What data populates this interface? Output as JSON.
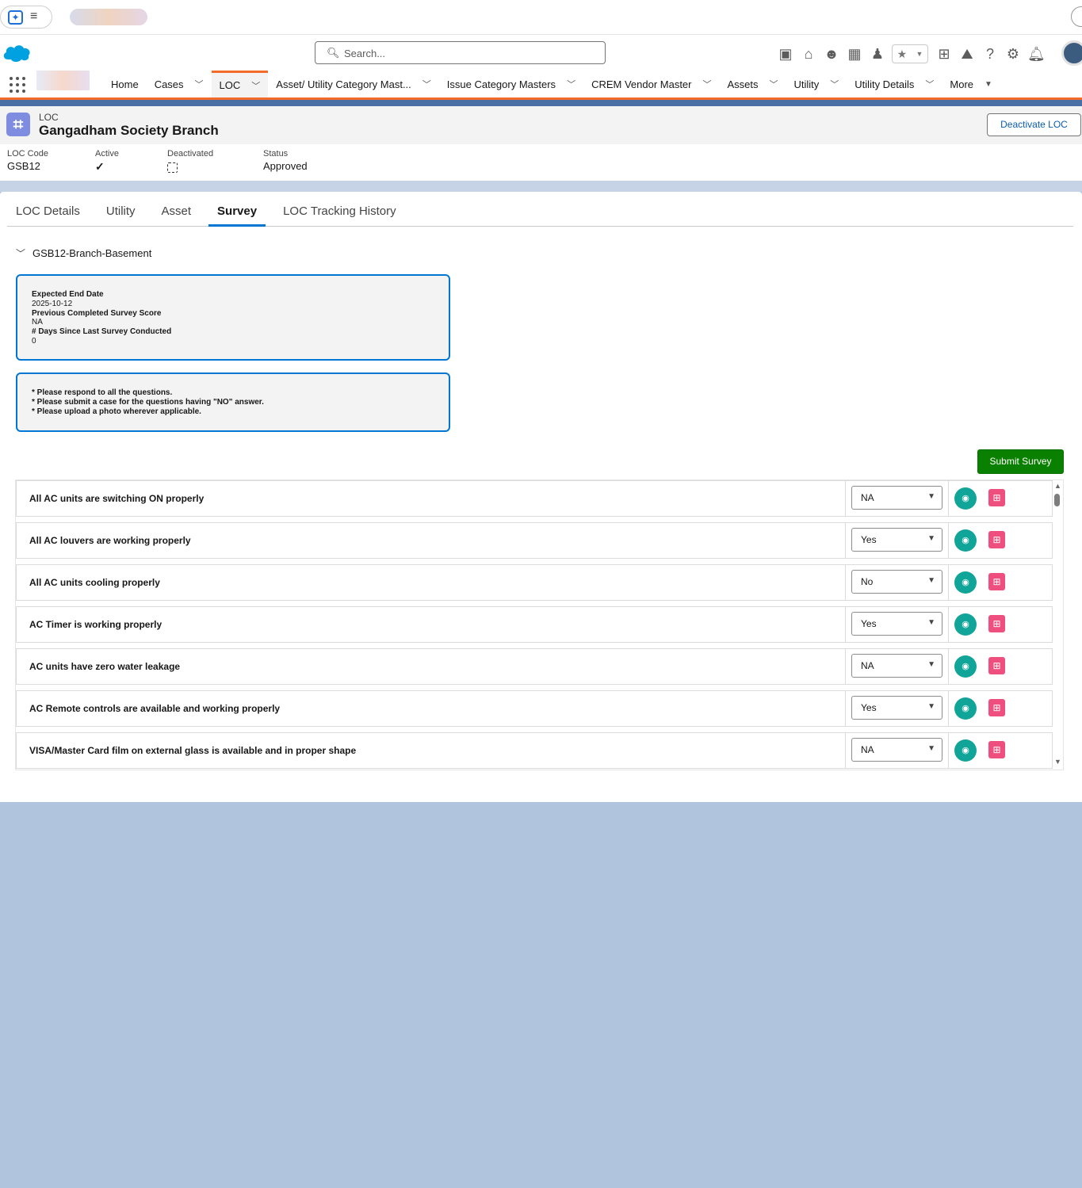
{
  "header": {
    "search_placeholder": "Search...",
    "icons": [
      "calendar-icon",
      "home-icon",
      "agent-icon",
      "dashboard-icon",
      "user-settings-icon",
      "plus-icon",
      "trailhead-icon",
      "help-icon",
      "gear-icon",
      "bell-icon"
    ]
  },
  "nav": {
    "items": [
      {
        "label": "Home",
        "chevron": false,
        "active": false
      },
      {
        "label": "Cases",
        "chevron": true,
        "active": false
      },
      {
        "label": "LOC",
        "chevron": true,
        "active": true
      },
      {
        "label": "Asset/ Utility Category Mast...",
        "chevron": true,
        "active": false
      },
      {
        "label": "Issue Category Masters",
        "chevron": true,
        "active": false
      },
      {
        "label": "CREM Vendor Master",
        "chevron": true,
        "active": false
      },
      {
        "label": "Assets",
        "chevron": true,
        "active": false
      },
      {
        "label": "Utility",
        "chevron": true,
        "active": false
      },
      {
        "label": "Utility Details",
        "chevron": true,
        "active": false
      }
    ],
    "more_label": "More"
  },
  "record": {
    "type_label": "LOC",
    "title": "Gangadham Society Branch",
    "deactivate_button": "Deactivate LOC",
    "fields": {
      "loc_code_label": "LOC Code",
      "loc_code_value": "GSB12",
      "active_label": "Active",
      "active_value": true,
      "deactivated_label": "Deactivated",
      "deactivated_value": false,
      "status_label": "Status",
      "status_value": "Approved"
    }
  },
  "tabs": [
    {
      "label": "LOC Details",
      "active": false
    },
    {
      "label": "Utility",
      "active": false
    },
    {
      "label": "Asset",
      "active": false
    },
    {
      "label": "Survey",
      "active": true
    },
    {
      "label": "LOC Tracking History",
      "active": false
    }
  ],
  "survey": {
    "section_title": "GSB12-Branch-Basement",
    "info": {
      "expected_end_date_label": "Expected End Date",
      "expected_end_date_value": "2025-10-12",
      "previous_score_label": "Previous Completed Survey Score",
      "previous_score_value": "NA",
      "days_since_label": "# Days Since Last Survey Conducted",
      "days_since_value": "0"
    },
    "instructions": [
      "* Please respond to all the questions.",
      "* Please submit a case for the questions having \"NO\" answer.",
      "* Please upload a photo wherever applicable."
    ],
    "submit_label": "Submit Survey",
    "questions": [
      {
        "text": "All AC units are switching ON properly",
        "answer": "NA"
      },
      {
        "text": "All AC louvers are working properly",
        "answer": "Yes"
      },
      {
        "text": "All AC units cooling properly",
        "answer": "No"
      },
      {
        "text": "AC Timer is working properly",
        "answer": "Yes"
      },
      {
        "text": "AC units have zero water leakage",
        "answer": "NA"
      },
      {
        "text": "AC Remote controls are available and working properly",
        "answer": "Yes"
      },
      {
        "text": "VISA/Master Card film on external glass is available and in proper shape",
        "answer": "NA"
      }
    ]
  },
  "colors": {
    "nav_accent": "#f26b2b",
    "brand_blue": "#0176d3",
    "submit_green": "#0a8000",
    "camera_teal": "#11a59a",
    "clipboard_pink": "#ef4f7e",
    "page_background": "#b0c4de"
  }
}
